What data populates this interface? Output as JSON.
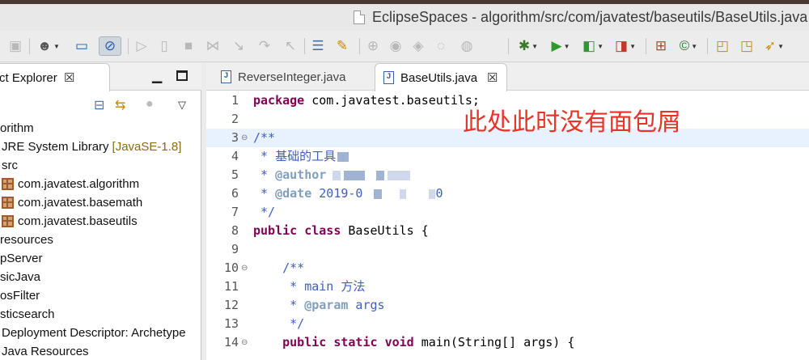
{
  "window": {
    "title": "EclipseSpaces - algorithm/src/com/javatest/baseutils/BaseUtils.java"
  },
  "toolbar": {
    "icons": [
      "save-icon",
      "profile-icon",
      "monitor-icon",
      "link-off-icon",
      "step-icon",
      "pause-icon",
      "stop-icon",
      "disconnect-icon",
      "step-into-icon",
      "step-over-icon",
      "step-return-icon",
      "drop-frame-icon",
      "task-icon",
      "debug-icon",
      "run-icon",
      "coverage-icon",
      "external-tools-icon",
      "new-java-class-icon",
      "search-icon",
      "open-folder-icon",
      "open-file-icon",
      "rocket-icon"
    ]
  },
  "explorer": {
    "tab_label": "ct Explorer",
    "close_glyph": "☒",
    "minimize_glyph": "▁",
    "tree": [
      {
        "label": "orithm",
        "kind": "project"
      },
      {
        "label": "JRE System Library",
        "tag": "[JavaSE-1.8]",
        "kind": "library"
      },
      {
        "label": "src",
        "kind": "folder"
      },
      {
        "label": "com.javatest.algorithm",
        "kind": "package"
      },
      {
        "label": "com.javatest.basemath",
        "kind": "package"
      },
      {
        "label": "com.javatest.baseutils",
        "kind": "package"
      },
      {
        "label": "resources",
        "kind": "folder"
      },
      {
        "label": "pServer",
        "kind": "project"
      },
      {
        "label": "sicJava",
        "kind": "project"
      },
      {
        "label": "osFilter",
        "kind": "project"
      },
      {
        "label": "sticsearch",
        "kind": "project"
      },
      {
        "label": "Deployment Descriptor: Archetype",
        "kind": "descriptor"
      },
      {
        "label": "Java Resources",
        "kind": "folder"
      }
    ]
  },
  "editor": {
    "tabs": [
      {
        "label": "ReverseInteger.java",
        "active": false
      },
      {
        "label": "BaseUtils.java",
        "active": true
      }
    ],
    "close_glyph": "☒",
    "lines": [
      {
        "n": "1",
        "fold": "",
        "parts": [
          [
            "kw",
            "package"
          ],
          [
            "",
            " com.javatest.baseutils;"
          ]
        ]
      },
      {
        "n": "2",
        "fold": "",
        "parts": []
      },
      {
        "n": "3",
        "fold": "⊖",
        "parts": [
          [
            "cm",
            "/**"
          ]
        ]
      },
      {
        "n": "4",
        "fold": "",
        "parts": [
          [
            "cm",
            " * 基础的工具"
          ]
        ]
      },
      {
        "n": "5",
        "fold": "",
        "parts": [
          [
            "cm",
            " * "
          ],
          [
            "tag",
            "@author"
          ]
        ]
      },
      {
        "n": "6",
        "fold": "",
        "parts": [
          [
            "cm",
            " * "
          ],
          [
            "tag",
            "@date"
          ],
          [
            "cm",
            " 2019-0"
          ]
        ]
      },
      {
        "n": "7",
        "fold": "",
        "parts": [
          [
            "cm",
            " */"
          ]
        ]
      },
      {
        "n": "8",
        "fold": "",
        "parts": [
          [
            "kw",
            "public"
          ],
          [
            "",
            " "
          ],
          [
            "kw",
            "class"
          ],
          [
            "",
            " BaseUtils {"
          ]
        ]
      },
      {
        "n": "9",
        "fold": "",
        "parts": []
      },
      {
        "n": "10",
        "fold": "⊖",
        "parts": [
          [
            "cm",
            "    /**"
          ]
        ]
      },
      {
        "n": "11",
        "fold": "",
        "parts": [
          [
            "cm",
            "     * main 方法"
          ]
        ]
      },
      {
        "n": "12",
        "fold": "",
        "parts": [
          [
            "cm",
            "     * "
          ],
          [
            "tag",
            "@param"
          ],
          [
            "cm",
            " args"
          ]
        ]
      },
      {
        "n": "13",
        "fold": "",
        "parts": [
          [
            "cm",
            "     */"
          ]
        ]
      },
      {
        "n": "14",
        "fold": "⊖",
        "parts": [
          [
            "",
            "    "
          ],
          [
            "kw",
            "public"
          ],
          [
            "",
            " "
          ],
          [
            "kw",
            "static"
          ],
          [
            "",
            " "
          ],
          [
            "kw",
            "void"
          ],
          [
            "",
            " main(String[] args) {"
          ]
        ]
      }
    ],
    "date_tail": "0"
  },
  "annotation": {
    "text": "此处此时没有面包屑",
    "color": "#e8332a"
  }
}
